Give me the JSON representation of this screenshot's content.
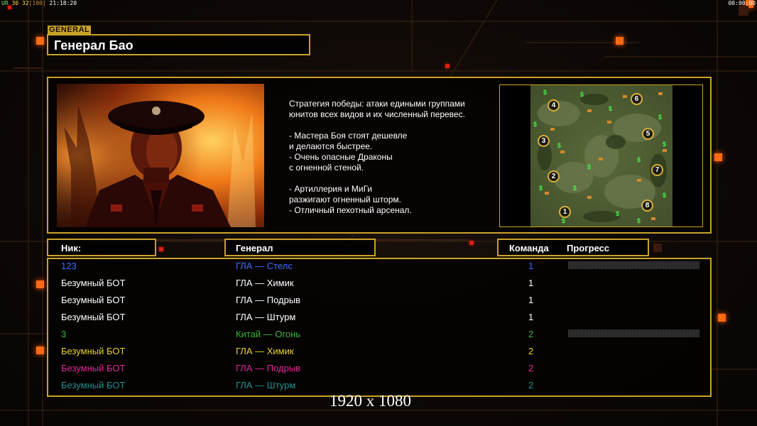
{
  "hud": {
    "left_ur": "UR",
    "left_a": "30",
    "left_b": "32",
    "left_c": "[100]",
    "left_time": "21:18:20",
    "right_time": "00:00:00"
  },
  "general": {
    "tag": "GENERAL",
    "name": "Генерал Бао"
  },
  "description": [
    "Стратегия победы: атаки едиными группами",
    "юнитов всех видов и их численный перевес.",
    "",
    "- Мастера Боя стоят дешевле",
    "и делаются быстрее.",
    "- Очень опасные Драконы",
    "с огненной стеной.",
    "",
    "- Артиллерия и МиГи",
    "разжигают огненный шторм.",
    "- Отличный пехотный арсенал."
  ],
  "map": {
    "slots": [
      "1",
      "2",
      "3",
      "4",
      "5",
      "6",
      "7",
      "8"
    ],
    "cash_icon": "$"
  },
  "columns": {
    "nick": "Ник:",
    "general": "Генерал",
    "team": "Команда",
    "progress": "Прогресс"
  },
  "players": [
    {
      "nick": "123",
      "general": "ГЛА — Стелс",
      "team": "1",
      "color": "#3f6bff",
      "progress": true
    },
    {
      "nick": "Безумный БОТ",
      "general": "ГЛА — Химик",
      "team": "1",
      "color": "#ffffff",
      "progress": false
    },
    {
      "nick": "Безумный БОТ",
      "general": "ГЛА — Подрыв",
      "team": "1",
      "color": "#ffffff",
      "progress": false
    },
    {
      "nick": "Безумный БОТ",
      "general": "ГЛА — Штурм",
      "team": "1",
      "color": "#ffffff",
      "progress": false
    },
    {
      "nick": "3",
      "general": "Китай — Огонь",
      "team": "2",
      "color": "#3cb43c",
      "progress": true
    },
    {
      "nick": "Безумный БОТ",
      "general": "ГЛА — Химик",
      "team": "2",
      "color": "#e6d22a",
      "progress": false
    },
    {
      "nick": "Безумный БОТ",
      "general": "ГЛА — Подрыв",
      "team": "2",
      "color": "#e0279a",
      "progress": false
    },
    {
      "nick": "Безумный БОТ",
      "general": "ГЛА — Штурм",
      "team": "2",
      "color": "#1f8f8f",
      "progress": false
    }
  ],
  "resolution": "1920 x 1080",
  "colors": {
    "frame": "#c9a22a",
    "accent_square": "#ff6a12"
  }
}
